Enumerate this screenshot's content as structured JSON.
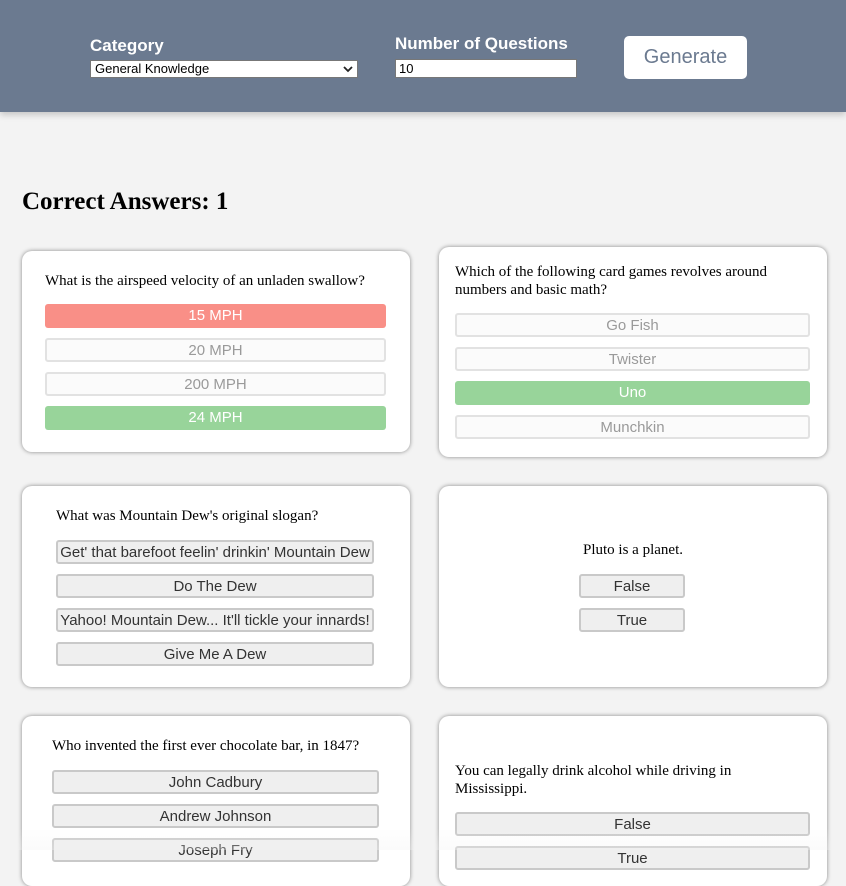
{
  "header": {
    "category_label": "Category",
    "category_value": "General Knowledge",
    "num_label": "Number of Questions",
    "num_value": "10",
    "generate_label": "Generate"
  },
  "score": {
    "text": "Correct Answers: 1"
  },
  "colors": {
    "header_bg": "#6b7a90",
    "wrong": "#f98f87",
    "correct": "#98d49a"
  },
  "cards": [
    {
      "question": "What is the airspeed velocity of an unladen swallow?",
      "options": [
        "15 MPH",
        "20 MPH",
        "200 MPH",
        "24 MPH"
      ],
      "states": [
        "wrong",
        "faded",
        "faded",
        "correct"
      ]
    },
    {
      "question": "Which of the following card games revolves around numbers and basic math?",
      "options": [
        "Go Fish",
        "Twister",
        "Uno",
        "Munchkin"
      ],
      "states": [
        "faded",
        "faded",
        "correct",
        "faded"
      ]
    },
    {
      "question": "What was Mountain Dew's original slogan?",
      "options": [
        "Get' that barefoot feelin' drinkin' Mountain Dew",
        "Do The Dew",
        "Yahoo! Mountain Dew... It'll tickle your innards!",
        "Give Me A Dew"
      ],
      "states": [
        "default",
        "default",
        "default",
        "default"
      ]
    },
    {
      "question": "Pluto is a planet.",
      "options": [
        "False",
        "True"
      ],
      "states": [
        "default",
        "default"
      ]
    },
    {
      "question": "Who invented the first ever chocolate bar, in 1847?",
      "options": [
        "John Cadbury",
        "Andrew Johnson",
        "Joseph Fry"
      ],
      "states": [
        "default",
        "default",
        "default"
      ]
    },
    {
      "question": "You can legally drink alcohol while driving in Mississippi.",
      "options": [
        "False",
        "True"
      ],
      "states": [
        "default",
        "default"
      ]
    }
  ]
}
